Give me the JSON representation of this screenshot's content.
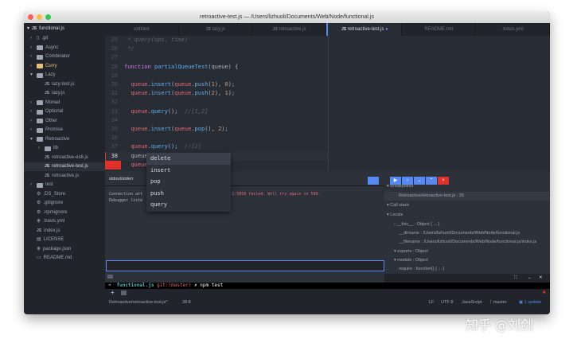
{
  "window": {
    "title": "retroactive-test.js — /Users/lizhuoli/Documents/Web/Node/functional.js"
  },
  "sidebar": {
    "root": "functional.js",
    "items": [
      {
        "label": ".git",
        "type": "repo",
        "depth": 1
      },
      {
        "label": "Async",
        "type": "folder",
        "depth": 1
      },
      {
        "label": "Combinator",
        "type": "folder",
        "depth": 1
      },
      {
        "label": "Curry",
        "type": "folder",
        "depth": 1,
        "highlight": true
      },
      {
        "label": "Lazy",
        "type": "folder-open",
        "depth": 1
      },
      {
        "label": "lazy-test.js",
        "type": "js",
        "depth": 2
      },
      {
        "label": "lazy.js",
        "type": "js",
        "depth": 2
      },
      {
        "label": "Monad",
        "type": "folder",
        "depth": 1
      },
      {
        "label": "Optional",
        "type": "folder",
        "depth": 1
      },
      {
        "label": "Other",
        "type": "folder",
        "depth": 1
      },
      {
        "label": "Promise",
        "type": "folder",
        "depth": 1
      },
      {
        "label": "Retroactive",
        "type": "folder-open",
        "depth": 1
      },
      {
        "label": "lib",
        "type": "folder",
        "depth": 2
      },
      {
        "label": "retroactive-es6.js",
        "type": "js",
        "depth": 2
      },
      {
        "label": "retroactive-test.js",
        "type": "js",
        "depth": 2,
        "selected": true
      },
      {
        "label": "retroactive.js",
        "type": "js",
        "depth": 2
      },
      {
        "label": "test",
        "type": "folder",
        "depth": 1
      },
      {
        "label": ".DS_Store",
        "type": "gear",
        "depth": 1
      },
      {
        "label": ".gitignore",
        "type": "gear",
        "depth": 1
      },
      {
        "label": ".npmignore",
        "type": "gear",
        "depth": 1
      },
      {
        "label": ".travis.yml",
        "type": "yml",
        "depth": 1
      },
      {
        "label": "index.js",
        "type": "js",
        "depth": 1
      },
      {
        "label": "LICENSE",
        "type": "file",
        "depth": 1
      },
      {
        "label": "package.json",
        "type": "yml",
        "depth": 1
      },
      {
        "label": "README.md",
        "type": "md",
        "depth": 1
      }
    ]
  },
  "tabs": [
    {
      "label": "untitled"
    },
    {
      "label": "lazy.js",
      "icon": "JS"
    },
    {
      "label": "retroactive.js",
      "icon": "JS"
    },
    {
      "label": "retroactive-test.js",
      "icon": "JS",
      "active": true
    },
    {
      "label": "README.md"
    },
    {
      "label": ".travis.yml"
    }
  ],
  "editor": {
    "lines": [
      {
        "n": "25",
        "html": "<span class='cm'> * query(ops, time)</span>"
      },
      {
        "n": "26",
        "html": "<span class='cm'> */</span>"
      },
      {
        "n": "27",
        "html": ""
      },
      {
        "n": "28",
        "html": "<span class='kw'>function</span> <span class='fn'>partialQueueTest</span><span class='pl'>(queue) {</span>"
      },
      {
        "n": "29",
        "html": ""
      },
      {
        "n": "30",
        "html": "  <span class='var'>queue</span><span class='pl'>.</span><span class='fn'>insert</span><span class='pl'>(</span><span class='var'>queue</span><span class='pl'>.</span><span class='fn'>push</span><span class='pl'>(</span><span class='num'>1</span><span class='pl'>), </span><span class='num'>0</span><span class='pl'>);</span>"
      },
      {
        "n": "31",
        "html": "  <span class='var'>queue</span><span class='pl'>.</span><span class='fn'>insert</span><span class='pl'>(</span><span class='var'>queue</span><span class='pl'>.</span><span class='fn'>push</span><span class='pl'>(</span><span class='num'>2</span><span class='pl'>), </span><span class='num'>1</span><span class='pl'>);</span>"
      },
      {
        "n": "32",
        "html": ""
      },
      {
        "n": "33",
        "html": "  <span class='var'>queue</span><span class='pl'>.</span><span class='fn'>query</span><span class='pl'>();  </span><span class='cm'>//[1,2]</span>"
      },
      {
        "n": "34",
        "html": ""
      },
      {
        "n": "35",
        "html": "  <span class='var'>queue</span><span class='pl'>.</span><span class='fn'>insert</span><span class='pl'>(</span><span class='var'>queue</span><span class='pl'>.</span><span class='fn'>pop</span><span class='pl'>(), </span><span class='num'>2</span><span class='pl'>);</span>"
      },
      {
        "n": "36",
        "html": ""
      },
      {
        "n": "37",
        "html": "  <span class='var'>queue</span><span class='pl'>.</span><span class='fn'>query</span><span class='pl'>();  </span><span class='cm'>//[2]</span>"
      },
      {
        "n": "38",
        "html": "  <span class='pl'>queue.</span>"
      },
      {
        "n": "39",
        "html": "  <span class='var'>queue</span>"
      },
      {
        "n": "40",
        "html": ""
      }
    ]
  },
  "autocomplete": [
    "delete",
    "insert",
    "pop",
    "push",
    "query"
  ],
  "console": {
    "tab": "stdout/stderr",
    "line1a": "Connection att",
    "line1b": "0.0.1:5858 failed. Will try again in 500.",
    "line2": "Debugger liste"
  },
  "debugger": {
    "breakpoints": "Breakpoints",
    "bp_item": "Retroactive/retroactive-test.js : 39",
    "callstack": "Call stack",
    "locals": "Locals",
    "vars": [
      "__this__ : Object { ... }",
      "__dirname : /Users/lizhuoli/Documents/Web/Node/functional.js",
      "__filename : /Users/lizhuoli/Documents/Web/Node/functional.js/index.js",
      "exports : Object",
      "module : Object",
      "require : function() { ... }"
    ]
  },
  "terminal": {
    "arrow": "➜",
    "dir": "functional.js",
    "git": "git:(master)",
    "cmd": "✗ npm test"
  },
  "status": {
    "file": "Retroactive/retroactive-test.js*",
    "pos": "38:8",
    "eol": "LF",
    "enc": "UTF-8",
    "grammar": "JavaScript",
    "branch": "master",
    "update": "1 update"
  },
  "watermark": "知乎 @刘剑",
  "colors": {
    "accent": "#568af2",
    "error": "#e0312b"
  }
}
